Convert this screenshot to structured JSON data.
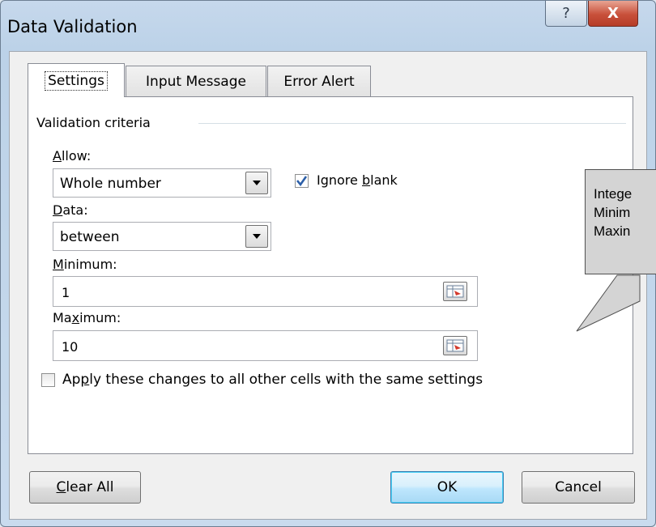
{
  "window": {
    "title": "Data Validation"
  },
  "title_buttons": {
    "help": "?",
    "close": "X"
  },
  "tabs": [
    {
      "label": "Settings",
      "active": true
    },
    {
      "label": "Input Message",
      "active": false
    },
    {
      "label": "Error Alert",
      "active": false
    }
  ],
  "settings": {
    "group_label": "Validation criteria",
    "allow": {
      "label_u": "A",
      "label_rest": "llow:",
      "value": "Whole number"
    },
    "ignore_blank": {
      "label_pre": "Ignore ",
      "label_u": "b",
      "label_rest": "lank",
      "checked": true
    },
    "data": {
      "label_u": "D",
      "label_rest": "ata:",
      "value": "between"
    },
    "minimum": {
      "label_u": "M",
      "label_rest": "inimum:",
      "value": "1"
    },
    "maximum": {
      "label_pre": "Ma",
      "label_u": "x",
      "label_rest": "imum:",
      "value": "10"
    },
    "apply_all": {
      "label_pre": "Ap",
      "label_u": "p",
      "label_rest": "ly these changes to all other cells with the same settings",
      "checked": false
    }
  },
  "buttons": {
    "clear_all_u": "C",
    "clear_all_rest": "lear All",
    "ok": "OK",
    "cancel": "Cancel"
  },
  "callout": {
    "line1": "Intege",
    "line2": "Minim",
    "line3": "Maxin"
  },
  "colors": {
    "checkmark": "#2c5fa8",
    "ref_icon_red": "#d33a2c",
    "close_button": "#c8503a"
  }
}
